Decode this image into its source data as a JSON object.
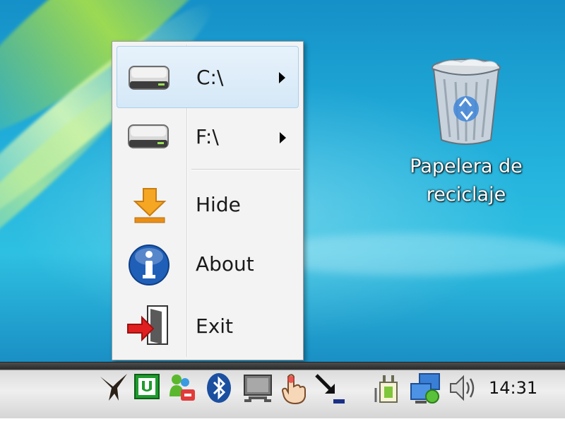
{
  "context_menu": {
    "items": [
      {
        "label": "C:\\",
        "icon": "drive-icon",
        "has_submenu": true,
        "highlighted": true
      },
      {
        "label": "F:\\",
        "icon": "drive-icon",
        "has_submenu": true,
        "highlighted": false
      },
      {
        "label": "Hide",
        "icon": "download-arrow-icon",
        "has_submenu": false,
        "highlighted": false
      },
      {
        "label": "About",
        "icon": "info-icon",
        "has_submenu": false,
        "highlighted": false
      },
      {
        "label": "Exit",
        "icon": "exit-door-icon",
        "has_submenu": false,
        "highlighted": false
      }
    ]
  },
  "desktop": {
    "recycle_bin": {
      "label_line1": "Papelera de",
      "label_line2": "reciclaje",
      "icon": "recycle-bin-icon"
    }
  },
  "taskbar": {
    "clock": "14:31",
    "tray_icons": [
      "eagle-icon",
      "utorrent-icon",
      "messenger-icon",
      "bluetooth-icon",
      "monitor-icon",
      "hand-pointer-icon",
      "arrow-down-right-icon",
      "power-plug-icon",
      "network-icon",
      "volume-icon"
    ]
  },
  "colors": {
    "menu_highlight": "#d5e8f7",
    "desktop_blue": "#23b2dc",
    "info_blue": "#1f5fb8",
    "exit_red": "#e02020",
    "hide_orange": "#f5a623"
  }
}
